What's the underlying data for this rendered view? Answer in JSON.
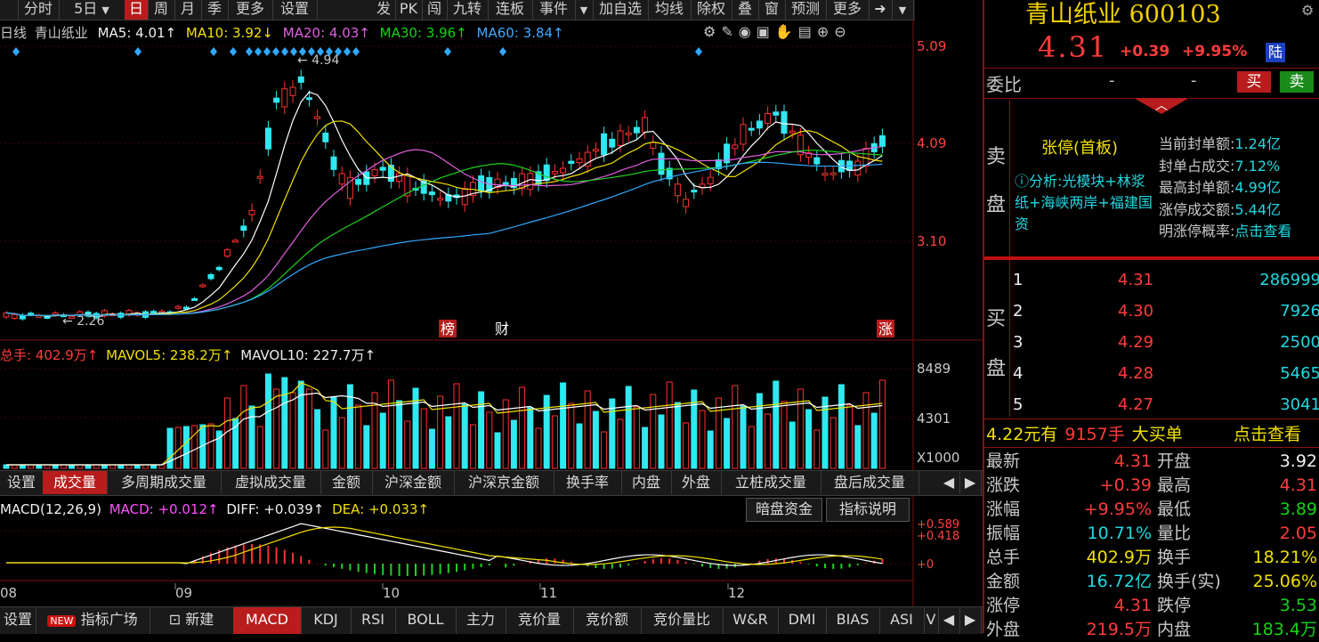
{
  "toolbar": {
    "tabs": [
      "分时",
      "5日",
      "日",
      "周",
      "月",
      "季",
      "更多",
      "设置"
    ],
    "right_tabs": [
      "发",
      "PK",
      "闯",
      "九转",
      "连板",
      "事件",
      "",
      "加自选",
      "均线",
      "除权",
      "叠",
      "窗",
      "预测",
      "更多"
    ]
  },
  "info": {
    "period": "日线",
    "name": "青山纸业",
    "ma5": "MA5: 4.01↑",
    "ma10": "MA10: 3.92↓",
    "ma20": "MA20: 4.03↑",
    "ma30": "MA30: 3.96↑",
    "ma60": "MA60: 3.84↑"
  },
  "price_axis": [
    "5.09",
    "4.09",
    "3.10"
  ],
  "chart_annotations": {
    "high_label": "4.94",
    "low_label": "2.26",
    "tag1": "榜",
    "tag2": "财",
    "tag3": "涨"
  },
  "volume": {
    "vol_label": "总手: 402.9万↑",
    "mavol5": "MAVOL5: 238.2万↑",
    "mavol10": "MAVOL10: 227.7万↑",
    "axis": [
      "8489",
      "4301",
      "X1000"
    ]
  },
  "indicator_tabs": [
    "设置",
    "成交量",
    "多周期成交量",
    "虚拟成交量",
    "金额",
    "沪深金额",
    "沪深京金额",
    "换手率",
    "内盘",
    "外盘",
    "立桩成交量",
    "盘后成交量"
  ],
  "macd": {
    "label": "MACD(12,26,9)",
    "macd": "MACD: +0.012↑",
    "diff": "DIFF: +0.039↑",
    "dea": "DEA: +0.033↑",
    "btn1": "暗盘资金",
    "btn2": "指标说明",
    "axis": [
      "+0.589",
      "+0.418",
      "+0"
    ]
  },
  "months": [
    "08",
    "09",
    "10",
    "11",
    "12"
  ],
  "bottom_tabs": [
    "设置",
    "NEW",
    "指标广场",
    "新建",
    "MACD",
    "KDJ",
    "RSI",
    "BOLL",
    "主力",
    "竞价量",
    "竞价额",
    "竞价量比",
    "W&R",
    "DMI",
    "BIAS",
    "ASI",
    "V"
  ],
  "stock": {
    "name": "青山纸业",
    "code": "600103",
    "price": "4.31",
    "change": "+0.39",
    "pct": "+9.95%",
    "market_tag": "陆"
  },
  "weibi": {
    "label": "委比",
    "v1": "-",
    "v2": "-",
    "buy": "买",
    "sell": "卖"
  },
  "sell_panel": {
    "side_label_1": "卖",
    "side_label_2": "盘",
    "limit_title": "张停(首板)",
    "analysis": "ⓘ分析:光模块+林浆纸+海峡两岸+福建国资",
    "stats": [
      {
        "k": "当前封单额:",
        "v": "1.24亿"
      },
      {
        "k": "封单占成交:",
        "v": "7.12%"
      },
      {
        "k": "最高封单额:",
        "v": "4.99亿"
      },
      {
        "k": "涨停成交额:",
        "v": "5.44亿"
      },
      {
        "k": "明涨停概率:",
        "v": "点击查看"
      }
    ]
  },
  "buy_panel": {
    "side_label_1": "买",
    "side_label_2": "盘",
    "rows": [
      {
        "lvl": "1",
        "price": "4.31",
        "vol": "286999"
      },
      {
        "lvl": "2",
        "price": "4.30",
        "vol": "7926"
      },
      {
        "lvl": "3",
        "price": "4.29",
        "vol": "2500"
      },
      {
        "lvl": "4",
        "price": "4.28",
        "vol": "5465"
      },
      {
        "lvl": "5",
        "price": "4.27",
        "vol": "3041"
      }
    ]
  },
  "big_order": {
    "price": "4.22元有",
    "qty": "9157手",
    "label": "大买单",
    "link": "点击查看"
  },
  "quote": [
    {
      "k1": "最新",
      "v1": "4.31",
      "c1": "red",
      "k2": "开盘",
      "v2": "3.92",
      "c2": "white"
    },
    {
      "k1": "涨跌",
      "v1": "+0.39",
      "c1": "red",
      "k2": "最高",
      "v2": "4.31",
      "c2": "red"
    },
    {
      "k1": "涨幅",
      "v1": "+9.95%",
      "c1": "red",
      "k2": "最低",
      "v2": "3.89",
      "c2": "green"
    },
    {
      "k1": "振幅",
      "v1": "10.71%",
      "c1": "cyan",
      "k2": "量比",
      "v2": "2.05",
      "c2": "red"
    },
    {
      "k1": "总手",
      "v1": "402.9万",
      "c1": "yellow",
      "k2": "换手",
      "v2": "18.21%",
      "c2": "yellow"
    },
    {
      "k1": "金额",
      "v1": "16.72亿",
      "c1": "cyan",
      "k2": "换手(实)",
      "v2": "25.06%",
      "c2": "yellow"
    },
    {
      "k1": "涨停",
      "v1": "4.31",
      "c1": "red",
      "k2": "跌停",
      "v2": "3.53",
      "c2": "green"
    },
    {
      "k1": "外盘",
      "v1": "219.5万",
      "c1": "red",
      "k2": "内盘",
      "v2": "183.4万",
      "c2": "green"
    }
  ]
}
